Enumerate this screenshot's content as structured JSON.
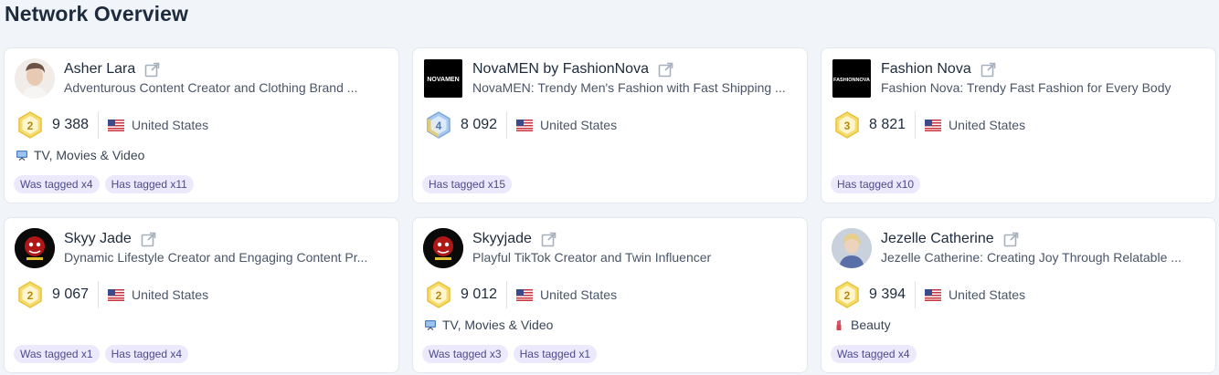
{
  "page": {
    "title": "Network Overview"
  },
  "colors": {
    "accent": "#ebe9fb",
    "tag_text": "#4d4a8c",
    "badge_gold": "#f3d35a",
    "badge_blue": "#8fb8e6"
  },
  "cards": [
    {
      "name": "Asher Lara",
      "description": "Adventurous Content Creator and Clothing Brand ...",
      "rank": "2",
      "score": "9 388",
      "country": "United States",
      "category": "TV, Movies & Video",
      "tags": [
        "Was tagged x4",
        "Has tagged x11"
      ]
    },
    {
      "name": "NovaMEN by FashionNova",
      "description": "NovaMEN: Trendy Men's Fashion with Fast Shipping ...",
      "rank": "4",
      "score": "8 092",
      "country": "United States",
      "category": "",
      "tags": [
        "Has tagged x15"
      ],
      "logo_text": "NOVAMEN"
    },
    {
      "name": "Fashion Nova",
      "description": "Fashion Nova: Trendy Fast Fashion for Every Body",
      "rank": "3",
      "score": "8 821",
      "country": "United States",
      "category": "",
      "tags": [
        "Has tagged x10"
      ],
      "logo_text": "FASHIONNOVA"
    },
    {
      "name": "Skyy Jade",
      "description": "Dynamic Lifestyle Creator and Engaging Content Pr...",
      "rank": "2",
      "score": "9 067",
      "country": "United States",
      "category": "",
      "tags": [
        "Was tagged x1",
        "Has tagged x4"
      ]
    },
    {
      "name": "Skyyjade",
      "description": "Playful TikTok Creator and Twin Influencer",
      "rank": "2",
      "score": "9 012",
      "country": "United States",
      "category": "TV, Movies & Video",
      "tags": [
        "Was tagged x3",
        "Has tagged x1"
      ]
    },
    {
      "name": "Jezelle Catherine",
      "description": "Jezelle Catherine: Creating Joy Through Relatable ...",
      "rank": "2",
      "score": "9 394",
      "country": "United States",
      "category": "Beauty",
      "tags": [
        "Was tagged x4"
      ]
    }
  ]
}
